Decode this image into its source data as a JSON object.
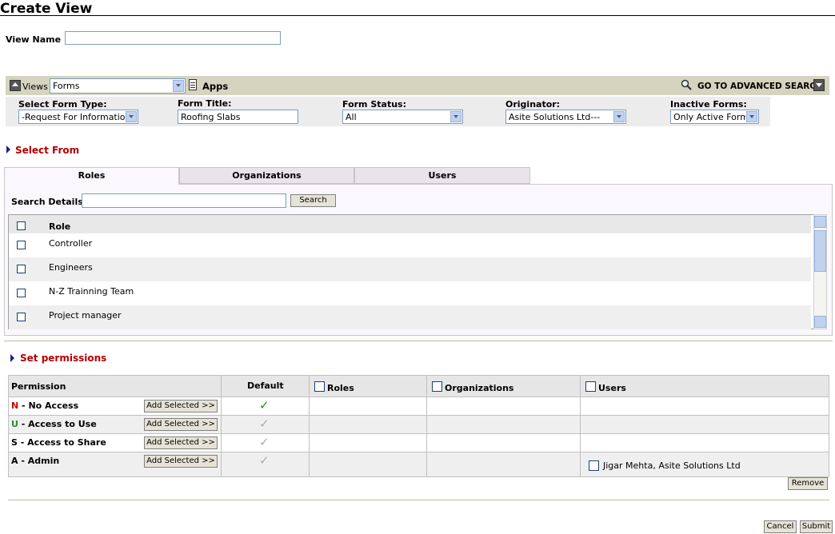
{
  "page": {
    "title": "Create View",
    "view_name_label": "View Name :",
    "view_name_value": ""
  },
  "views_bar": {
    "views_label": "Views",
    "views_selected": "Forms",
    "apps_label": "Apps",
    "advanced_search_label": "GO TO ADVANCED SEARCH"
  },
  "filters": {
    "form_type_label": "Select Form Type:",
    "form_type_value": "-Request For Information",
    "form_title_label": "Form Title:",
    "form_title_value": "Roofing Slabs",
    "form_status_label": "Form Status:",
    "form_status_value": "All",
    "originator_label": "Originator:",
    "originator_value": "Asite Solutions Ltd---",
    "inactive_label": "Inactive Forms:",
    "inactive_value": "Only Active Forms"
  },
  "select_from": {
    "heading": "Select From",
    "tabs": [
      {
        "label": "Roles",
        "active": true
      },
      {
        "label": "Organizations",
        "active": false
      },
      {
        "label": "Users",
        "active": false
      }
    ],
    "search_label": "Search Details:",
    "search_value": "",
    "search_button": "Search",
    "column_header": "Role",
    "roles": [
      "Controller",
      "Engineers",
      "N-Z Trainning Team",
      "Project manager"
    ]
  },
  "permissions": {
    "heading": "Set permissions",
    "headers": {
      "permission": "Permission",
      "default": "Default",
      "roles": "Roles",
      "organizations": "Organizations",
      "users": "Users"
    },
    "add_button": "Add Selected >>",
    "rows": [
      {
        "letter": "N",
        "letter_color": "#cc0000",
        "name": " - No Access",
        "default_checked": true,
        "check_color": "#2a8a2a"
      },
      {
        "letter": "U",
        "letter_color": "#2a8a2a",
        "name": " - Access to Use",
        "default_checked": true,
        "check_color": "#aaaaaa"
      },
      {
        "letter": "S",
        "letter_color": "#000000",
        "name": " - Access to Share",
        "default_checked": true,
        "check_color": "#aaaaaa"
      },
      {
        "letter": "A",
        "letter_color": "#000000",
        "name": " - Admin",
        "default_checked": true,
        "check_color": "#aaaaaa",
        "users": [
          "Jigar Mehta, Asite Solutions Ltd"
        ]
      }
    ],
    "remove_button": "Remove"
  },
  "footer": {
    "cancel_button": "Cancel",
    "submit_button": "Submit"
  },
  "colors": {
    "bar_bg": "#d4d4bf",
    "section_heading": "#b40000",
    "row_alt": "#efefef"
  }
}
